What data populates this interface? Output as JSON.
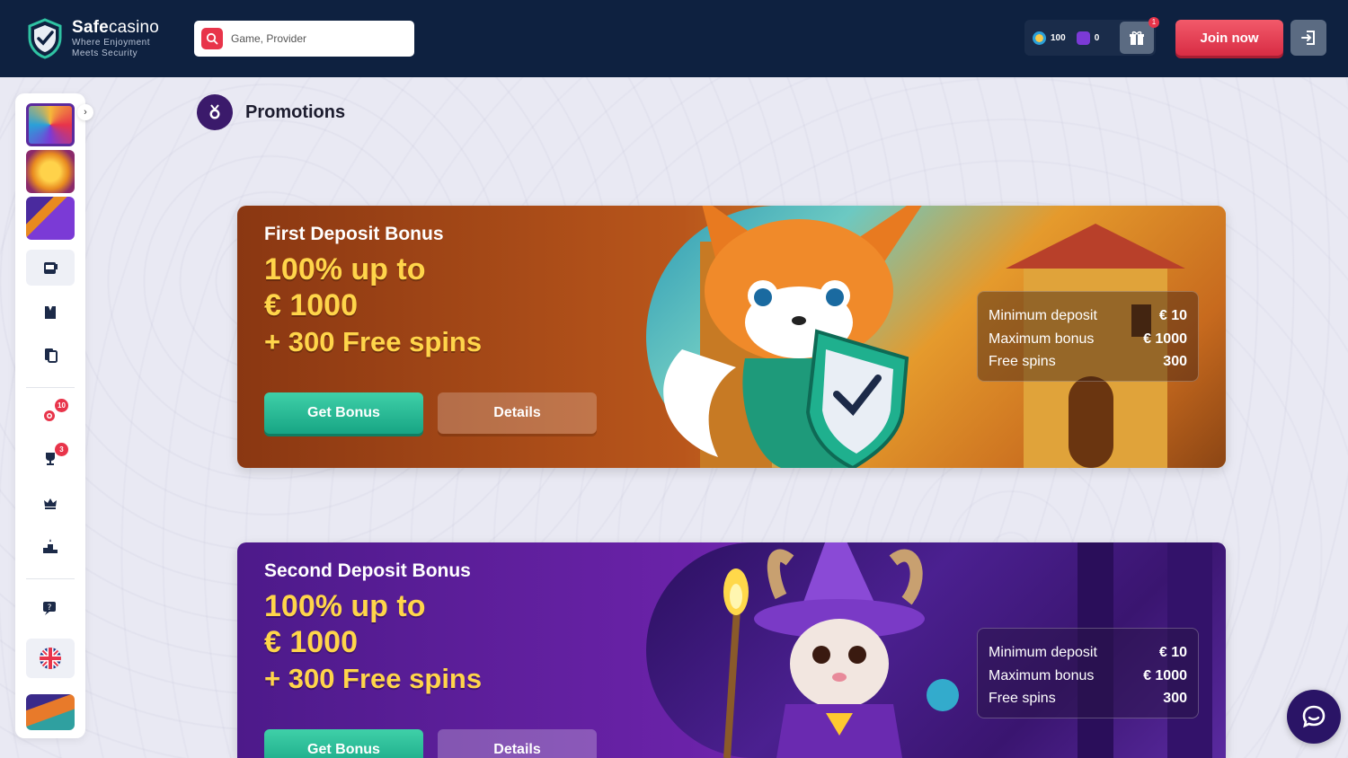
{
  "header": {
    "brand": "Safe",
    "brand_suffix": "casino",
    "tagline_1": "Where Enjoyment",
    "tagline_2": "Meets Security",
    "search_placeholder": "Game, Provider",
    "coins": "100",
    "free_spins": "0",
    "gift_count": "1",
    "join_label": "Join now"
  },
  "sidebar": {
    "tournaments_badge": "10",
    "trophy_badge": "3"
  },
  "page": {
    "title": "Promotions"
  },
  "promos": [
    {
      "subtitle": "First Deposit Bonus",
      "line1": "100% up to",
      "line2": "€ 1000",
      "line3": "+ 300 Free spins",
      "get_bonus": "Get Bonus",
      "details": "Details",
      "min_deposit_label": "Minimum deposit",
      "min_deposit_value": "€ 10",
      "max_bonus_label": "Maximum bonus",
      "max_bonus_value": "€ 1000",
      "free_spins_label": "Free spins",
      "free_spins_value": "300"
    },
    {
      "subtitle": "Second Deposit Bonus",
      "line1": "100% up to",
      "line2": "€ 1000",
      "line3": "+ 300 Free spins",
      "get_bonus": "Get Bonus",
      "details": "Details",
      "min_deposit_label": "Minimum deposit",
      "min_deposit_value": "€ 10",
      "max_bonus_label": "Maximum bonus",
      "max_bonus_value": "€ 1000",
      "free_spins_label": "Free spins",
      "free_spins_value": "300"
    }
  ],
  "colors": {
    "header_bg": "#0e2140",
    "accent_red": "#e8344a",
    "accent_green": "#17a584",
    "promo_yellow": "#ffd54a"
  }
}
